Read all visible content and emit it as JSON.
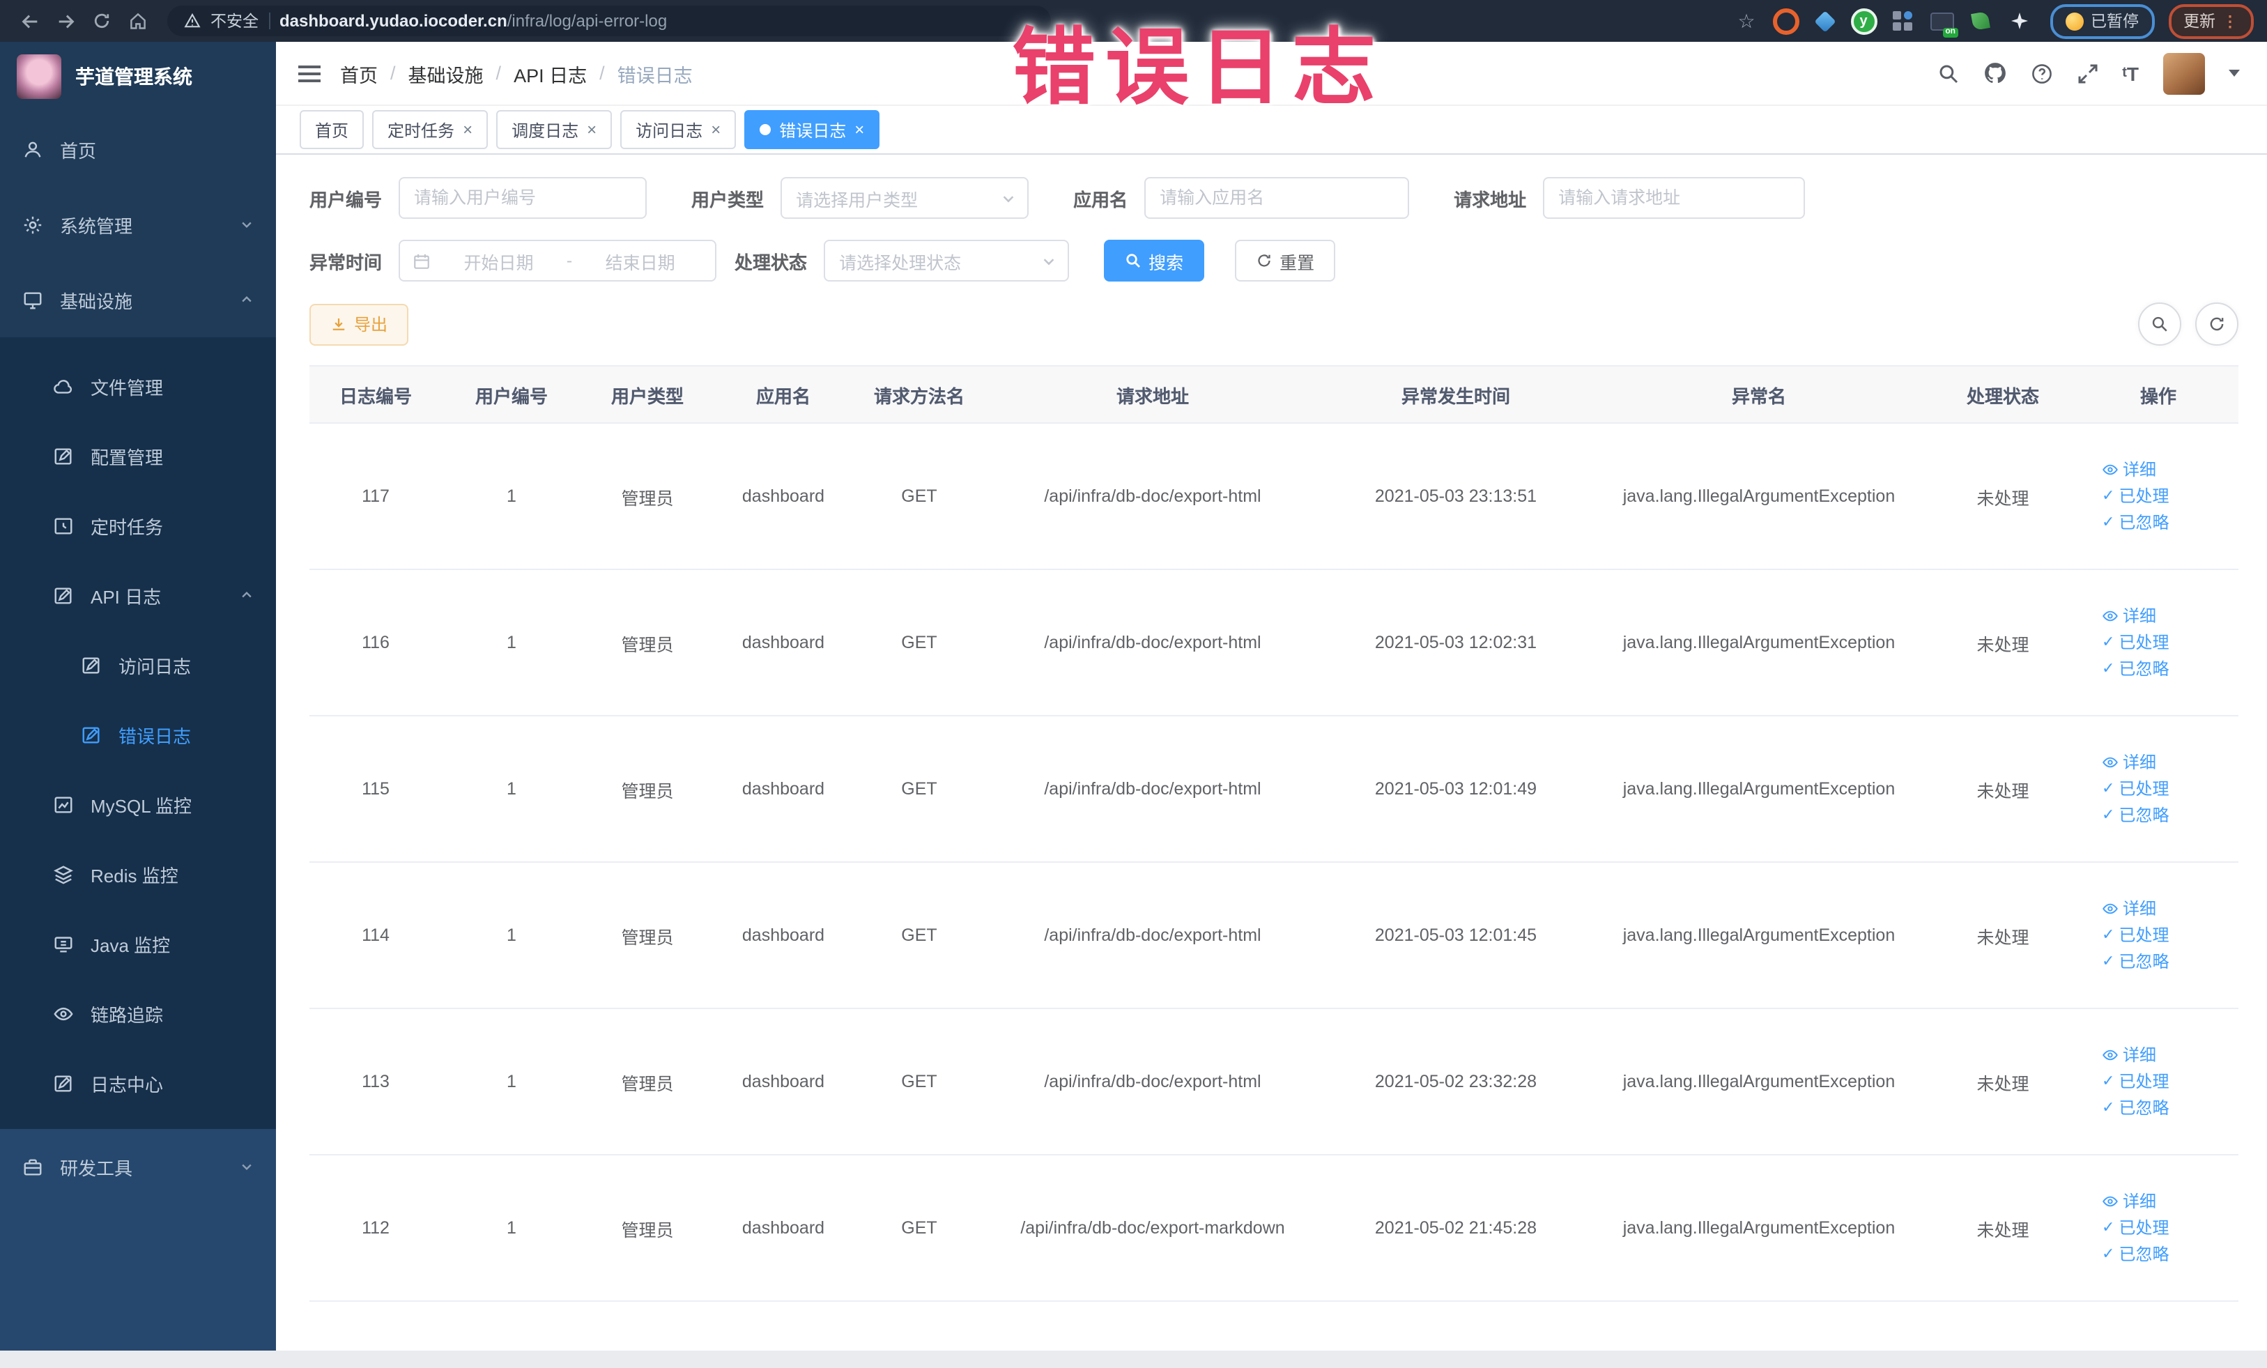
{
  "browser": {
    "security_label": "不安全",
    "url_domain": "dashboard.yudao.iocoder.cn",
    "url_path": "/infra/log/api-error-log",
    "paused_label": "已暂停",
    "update_label": "更新"
  },
  "annotation": {
    "text": "错误日志"
  },
  "sidebar": {
    "title": "芋道管理系统",
    "items": [
      {
        "label": "首页"
      },
      {
        "label": "系统管理"
      },
      {
        "label": "基础设施"
      },
      {
        "label": "文件管理"
      },
      {
        "label": "配置管理"
      },
      {
        "label": "定时任务"
      },
      {
        "label": "API 日志"
      },
      {
        "label": "访问日志"
      },
      {
        "label": "错误日志"
      },
      {
        "label": "MySQL 监控"
      },
      {
        "label": "Redis 监控"
      },
      {
        "label": "Java 监控"
      },
      {
        "label": "链路追踪"
      },
      {
        "label": "日志中心"
      },
      {
        "label": "研发工具"
      }
    ]
  },
  "breadcrumb": [
    "首页",
    "基础设施",
    "API 日志",
    "错误日志"
  ],
  "tabs": [
    {
      "label": "首页"
    },
    {
      "label": "定时任务"
    },
    {
      "label": "调度日志"
    },
    {
      "label": "访问日志"
    },
    {
      "label": "错误日志"
    }
  ],
  "filters": {
    "user_id": {
      "label": "用户编号",
      "placeholder": "请输入用户编号"
    },
    "user_type": {
      "label": "用户类型",
      "placeholder": "请选择用户类型"
    },
    "app_name": {
      "label": "应用名",
      "placeholder": "请输入应用名"
    },
    "request_url": {
      "label": "请求地址",
      "placeholder": "请输入请求地址"
    },
    "exception_time": {
      "label": "异常时间",
      "start_placeholder": "开始日期",
      "separator": "-",
      "end_placeholder": "结束日期"
    },
    "process_status": {
      "label": "处理状态",
      "placeholder": "请选择处理状态"
    },
    "search_label": "搜索",
    "reset_label": "重置"
  },
  "toolbar": {
    "export_label": "导出"
  },
  "table": {
    "columns": [
      "日志编号",
      "用户编号",
      "用户类型",
      "应用名",
      "请求方法名",
      "请求地址",
      "异常发生时间",
      "异常名",
      "处理状态",
      "操作"
    ],
    "actions": [
      "详细",
      "已处理",
      "已忽略"
    ],
    "rows": [
      {
        "log_id": "117",
        "user_id": "1",
        "user_type": "管理员",
        "app_name": "dashboard",
        "method": "GET",
        "url": "/api/infra/db-doc/export-html",
        "time": "2021-05-03 23:13:51",
        "exception": "java.lang.IllegalArgumentException",
        "status": "未处理"
      },
      {
        "log_id": "116",
        "user_id": "1",
        "user_type": "管理员",
        "app_name": "dashboard",
        "method": "GET",
        "url": "/api/infra/db-doc/export-html",
        "time": "2021-05-03 12:02:31",
        "exception": "java.lang.IllegalArgumentException",
        "status": "未处理"
      },
      {
        "log_id": "115",
        "user_id": "1",
        "user_type": "管理员",
        "app_name": "dashboard",
        "method": "GET",
        "url": "/api/infra/db-doc/export-html",
        "time": "2021-05-03 12:01:49",
        "exception": "java.lang.IllegalArgumentException",
        "status": "未处理"
      },
      {
        "log_id": "114",
        "user_id": "1",
        "user_type": "管理员",
        "app_name": "dashboard",
        "method": "GET",
        "url": "/api/infra/db-doc/export-html",
        "time": "2021-05-03 12:01:45",
        "exception": "java.lang.IllegalArgumentException",
        "status": "未处理"
      },
      {
        "log_id": "113",
        "user_id": "1",
        "user_type": "管理员",
        "app_name": "dashboard",
        "method": "GET",
        "url": "/api/infra/db-doc/export-html",
        "time": "2021-05-02 23:32:28",
        "exception": "java.lang.IllegalArgumentException",
        "status": "未处理"
      },
      {
        "log_id": "112",
        "user_id": "1",
        "user_type": "管理员",
        "app_name": "dashboard",
        "method": "GET",
        "url": "/api/infra/db-doc/export-markdown",
        "time": "2021-05-02 21:45:28",
        "exception": "java.lang.IllegalArgumentException",
        "status": "未处理"
      }
    ]
  },
  "colors": {
    "accent": "#409eff",
    "warning": "#e6a23c",
    "annotation_pink": "#e9416b",
    "sidebar_bg": "#1f3b58"
  }
}
